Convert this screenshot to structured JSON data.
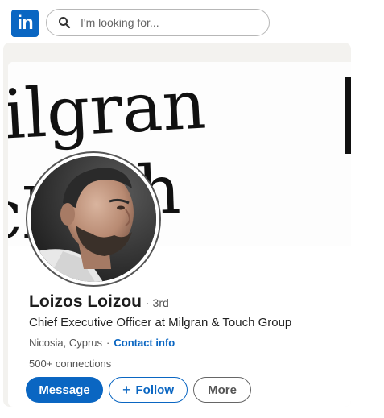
{
  "header": {
    "logo_text": "in",
    "search": {
      "placeholder": "I'm looking for...",
      "icon": "search-icon"
    }
  },
  "profile": {
    "banner_text": [
      "ilgran",
      "ch",
      "h"
    ],
    "name": "Loizos Loizou",
    "degree": "· 3rd",
    "headline": "Chief Executive Officer at Milgran & Touch Group",
    "location": "Nicosia, Cyprus",
    "location_separator": "·",
    "contact_info": "Contact info",
    "connections": "500+ connections",
    "actions": {
      "message": "Message",
      "follow_icon": "+",
      "follow": "Follow",
      "more": "More"
    }
  },
  "colors": {
    "brand": "#0a66c2",
    "text_primary": "#1d1d1d",
    "text_secondary": "#555555",
    "page_background": "#f3f2ef"
  }
}
